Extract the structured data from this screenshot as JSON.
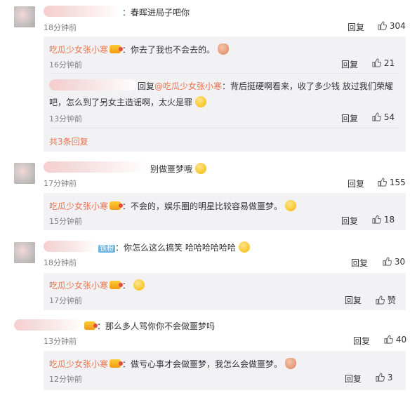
{
  "ops": {
    "reply": "回复",
    "like_word": "赞"
  },
  "comments": [
    {
      "text": "：春晖进局子吧你",
      "time": "18分钟前",
      "likes": "304"
    },
    {
      "user": "吃瓜少女张小寒",
      "text": "：你去了我也不会去的。",
      "time": "16分钟前",
      "likes": "21"
    },
    {
      "prefix": "回复",
      "mention": "@吃瓜少女张小寒",
      "text_line1": "：背后挺硬啊看来，收了多少钱 放过我们荣耀",
      "text_line2": "吧，怎么到了另女主造谣啊，太火是罪",
      "time": "13分钟前",
      "likes": "54"
    },
    {
      "more": "共3条回复"
    },
    {
      "text": "别做噩梦哦",
      "time": "17分钟前",
      "likes": "155"
    },
    {
      "user": "吃瓜少女张小寒",
      "text": "：不会的，娱乐圈的明星比较容易做噩梦。",
      "time": "15分钟前",
      "likes": "18"
    },
    {
      "tag": "铁粉",
      "text": "：你怎么这么搞笑 哈哈哈哈哈哈",
      "time": "18分钟前",
      "likes": "30"
    },
    {
      "user": "吃瓜少女张小寒",
      "text": "：",
      "time": "17分钟前"
    },
    {
      "text": "：那么多人骂你你不会做噩梦吗",
      "time": "13分钟前",
      "likes": "40"
    },
    {
      "user": "吃瓜少女张小寒",
      "text": "：做亏心事才会做噩梦，我怎么会做噩梦。",
      "time": "12分钟前",
      "likes": "3"
    }
  ]
}
